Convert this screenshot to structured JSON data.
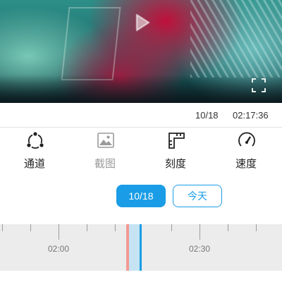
{
  "player": {
    "play_icon": "play-icon",
    "fullscreen_icon": "fullscreen-icon"
  },
  "info": {
    "date": "10/18",
    "time": "02:17:36"
  },
  "toolbar": {
    "channel_label": "通道",
    "channel_icon": "channel-icon",
    "screenshot_label": "截图",
    "screenshot_icon": "image-icon",
    "scale_label": "刻度",
    "scale_icon": "ruler-icon",
    "speed_label": "速度",
    "speed_icon": "speedometer-icon"
  },
  "date_chips": {
    "selected_date": "10/18",
    "today": "今天"
  },
  "timeline": {
    "labels": [
      "02:00",
      "02:30"
    ]
  },
  "colors": {
    "accent": "#1a9de6",
    "recording": "#c5e3f2",
    "alarm": "#f29b92",
    "timeline_bg": "#ececec"
  }
}
